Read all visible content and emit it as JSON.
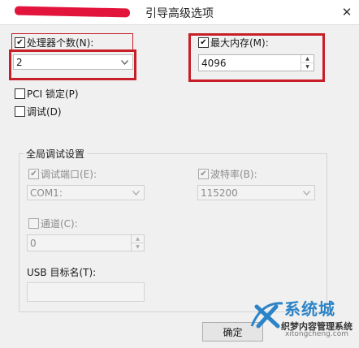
{
  "window": {
    "title": "引导高级选项",
    "close_glyph": "✕"
  },
  "processor_count": {
    "label": "处理器个数(N):",
    "checked": true,
    "value": "2"
  },
  "max_memory": {
    "label": "最大内存(M):",
    "checked": true,
    "value": "4096"
  },
  "pci_lock": {
    "label": "PCI 锁定(P)",
    "checked": false
  },
  "debug": {
    "label": "调试(D)",
    "checked": false
  },
  "global_debug": {
    "title": "全局调试设置",
    "debug_port": {
      "label": "调试端口(E):",
      "checked": true,
      "value": "COM1:"
    },
    "baud_rate": {
      "label": "波特率(B):",
      "checked": true,
      "value": "115200"
    },
    "channel": {
      "label": "通道(C):",
      "checked": false,
      "value": "0"
    },
    "usb_target": {
      "label": "USB 目标名(T):",
      "value": ""
    }
  },
  "buttons": {
    "ok": "确定"
  },
  "watermark": {
    "brand": "系统城",
    "site_name": "织梦内容管理系统",
    "domain": "DEDECMS.COM",
    "url": "xitongcheng.com"
  },
  "colors": {
    "highlight": "#c81e28",
    "redaction": "#e2143c",
    "watermark_blue": "#2c84c8"
  },
  "icons": {
    "checkbox_checked": "check-mark",
    "dropdown": "chevron-down-icon",
    "spinner_up": "triangle-up-icon",
    "spinner_down": "triangle-down-icon",
    "close": "close-icon"
  }
}
